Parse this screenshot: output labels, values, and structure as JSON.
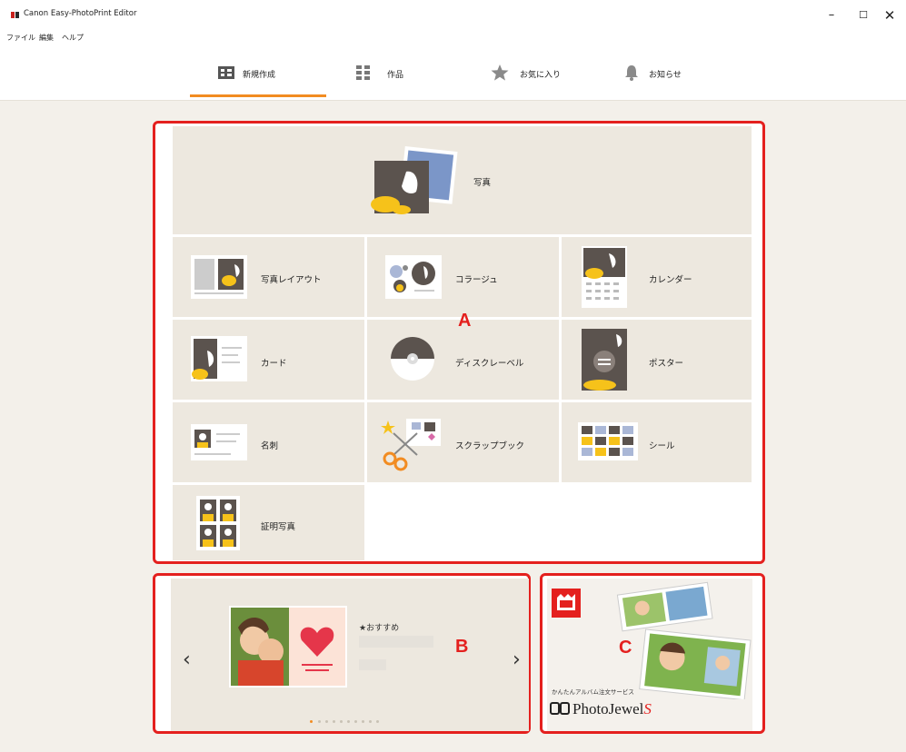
{
  "window": {
    "title": "Canon Easy-PhotoPrint Editor",
    "minimize": "–",
    "maximize": "☐",
    "close": "✕"
  },
  "menu": [
    "ファイル",
    "編集",
    "ヘルプ"
  ],
  "nav": {
    "active": "tab-new",
    "accent_color": "#f28c22",
    "tabs": [
      {
        "id": "new",
        "label": "新規作成",
        "icon": "new-project-icon"
      },
      {
        "id": "works",
        "label": "作品",
        "icon": "grid-icon"
      },
      {
        "id": "favorites",
        "label": "お気に入り",
        "icon": "star-icon"
      },
      {
        "id": "notices",
        "label": "お知らせ",
        "icon": "bell-icon"
      }
    ]
  },
  "section_a": {
    "marker": "A",
    "photo_tile": "写真",
    "tiles": [
      "写真レイアウト",
      "コラージュ",
      "カレンダー",
      "カード",
      "ディスクレーベル",
      "ポスター",
      "名刺",
      "スクラップブック",
      "シール",
      "証明写真"
    ]
  },
  "section_b": {
    "marker": "B",
    "title": "★おすすめ",
    "prev": "‹",
    "next": "›",
    "dot_count": 10,
    "active_dot": 0
  },
  "section_c": {
    "marker": "C",
    "tagline": "かんたんアルバム注文サービス",
    "brand": "PhotoJewel",
    "brand_suffix": "S"
  },
  "colors": {
    "highlight_border": "#e4201e",
    "tile_bg": "#ede8df",
    "page_bg": "#f3f0ea"
  }
}
